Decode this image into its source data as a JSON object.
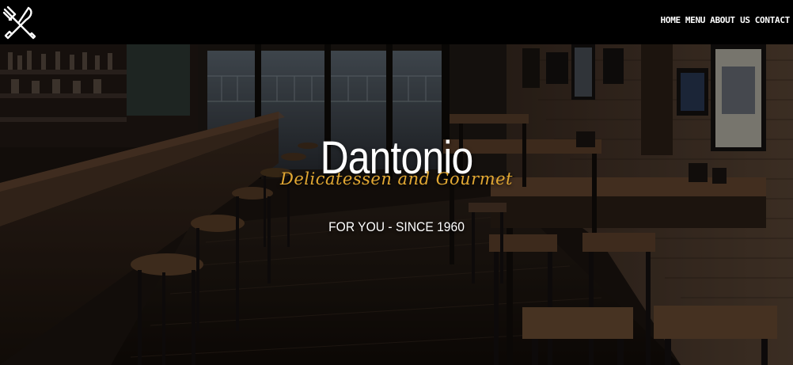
{
  "brand": {
    "logo_icon": "fork-and-knife-icon"
  },
  "nav": {
    "items": [
      {
        "label": "HOME"
      },
      {
        "label": "MENU"
      },
      {
        "label": "ABOUT US"
      },
      {
        "label": "CONTACT"
      }
    ]
  },
  "hero": {
    "title": "Dantonio",
    "tagline": "Delicatessen and Gourmet",
    "since": "FOR YOU - SINCE 1960"
  },
  "colors": {
    "header_bg": "#000000",
    "nav_text": "#ffffff",
    "tagline": "#e2a833",
    "title": "#ffffff"
  }
}
